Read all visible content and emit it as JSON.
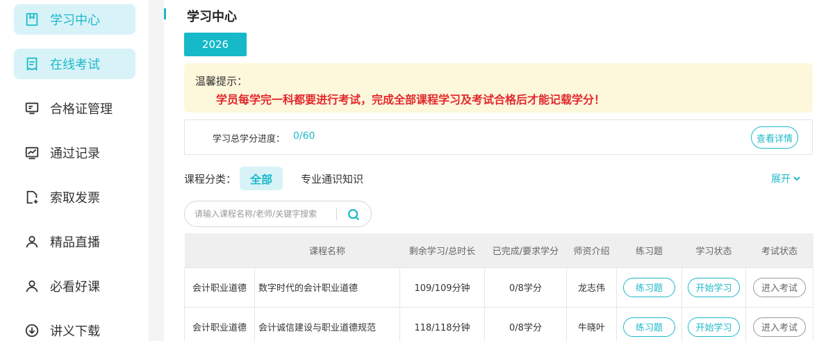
{
  "sidebar": {
    "items": [
      {
        "label": "学习中心",
        "icon": "bookmark-book-icon",
        "active": true
      },
      {
        "label": "在线考试",
        "icon": "exam-paper-icon",
        "active": true
      },
      {
        "label": "合格证管理",
        "icon": "certificate-icon",
        "active": false
      },
      {
        "label": "通过记录",
        "icon": "chart-record-icon",
        "active": false
      },
      {
        "label": "索取发票",
        "icon": "invoice-add-icon",
        "active": false
      },
      {
        "label": "精品直播",
        "icon": "user-icon",
        "active": false
      },
      {
        "label": "必看好课",
        "icon": "user-icon",
        "active": false
      },
      {
        "label": "讲义下载",
        "icon": "download-icon",
        "active": false
      }
    ],
    "colors": {
      "accent": "#1cb8c9",
      "active_bg": "#d8f3f8"
    }
  },
  "main": {
    "title": "学习中心",
    "year_button": "2026",
    "notice": {
      "label": "温馨提示：",
      "text": "学员每学完一科都要进行考试，完成全部课程学习及考试合格后才能记载学分！",
      "color": "#e2282c",
      "background": "#fdf7dc"
    },
    "progress": {
      "label": "学习总学分进度：",
      "value": "0/60",
      "detail_button": "查看详情"
    },
    "category": {
      "label": "课程分类：",
      "options": [
        "全部",
        "专业通识知识"
      ],
      "selected": "全部",
      "expand_label": "展开"
    },
    "search": {
      "placeholder": "请输入课程名称/老师/关键字搜索"
    },
    "table": {
      "headers": [
        "",
        "课程名称",
        "剩余学习/总时长",
        "已完成/要求学分",
        "师资介绍",
        "练习题",
        "学习状态",
        "考试状态"
      ],
      "rows": [
        {
          "category": "会计职业道德",
          "name": "数字时代的会计职业道德",
          "duration": "109/109分钟",
          "credits": "0/8学分",
          "teacher": "龙志伟",
          "practice": "练习题",
          "study": "开始学习",
          "exam": "进入考试"
        },
        {
          "category": "会计职业道德",
          "name": "会计诚信建设与职业道德规范",
          "duration": "118/118分钟",
          "credits": "0/8学分",
          "teacher": "牛晓叶",
          "practice": "练习题",
          "study": "开始学习",
          "exam": "进入考试"
        }
      ]
    }
  }
}
